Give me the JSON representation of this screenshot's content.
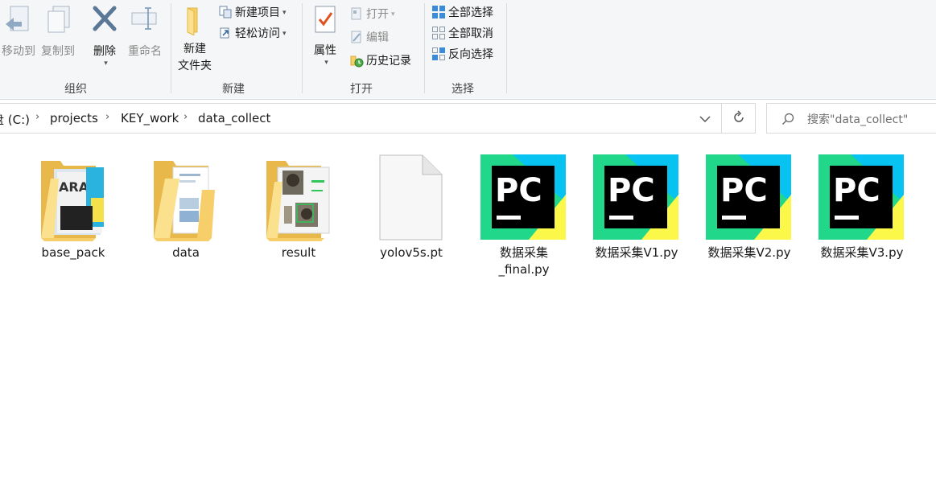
{
  "ribbon": {
    "organize": {
      "group_label": "组织",
      "move_to": "移动到",
      "copy_to": "复制到",
      "delete": "删除",
      "rename": "重命名"
    },
    "new": {
      "group_label": "新建",
      "new_folder_line1": "新建",
      "new_folder_line2": "文件夹",
      "new_item": "新建项目",
      "easy_access": "轻松访问"
    },
    "open": {
      "group_label": "打开",
      "properties": "属性",
      "open": "打开",
      "edit": "编辑",
      "history": "历史记录"
    },
    "select": {
      "group_label": "选择",
      "select_all": "全部选择",
      "select_none": "全部取消",
      "invert": "反向选择"
    }
  },
  "address": {
    "crumbs": [
      "盘 (C:)",
      "projects",
      "KEY_work",
      "data_collect"
    ],
    "search_placeholder": "搜索\"data_collect\""
  },
  "files": [
    {
      "name": "base_pack",
      "type": "folder"
    },
    {
      "name": "data",
      "type": "folder"
    },
    {
      "name": "result",
      "type": "folder"
    },
    {
      "name": "yolov5s.pt",
      "type": "file"
    },
    {
      "name_line1": "数据采集",
      "name_line2": "_final.py",
      "type": "pycharm",
      "icon_text": "PC"
    },
    {
      "name": "数据采集V1.py",
      "type": "pycharm",
      "icon_text": "PC"
    },
    {
      "name": "数据采集V2.py",
      "type": "pycharm",
      "icon_text": "PC"
    },
    {
      "name": "数据采集V3.py",
      "type": "pycharm",
      "icon_text": "PC"
    }
  ],
  "colors": {
    "folder": "#f6cf6a",
    "pycharm_green": "#21d789",
    "pycharm_yellow": "#fcf84a",
    "pycharm_blue": "#07c3f2",
    "ribbon_bg": "#f5f6f7"
  }
}
